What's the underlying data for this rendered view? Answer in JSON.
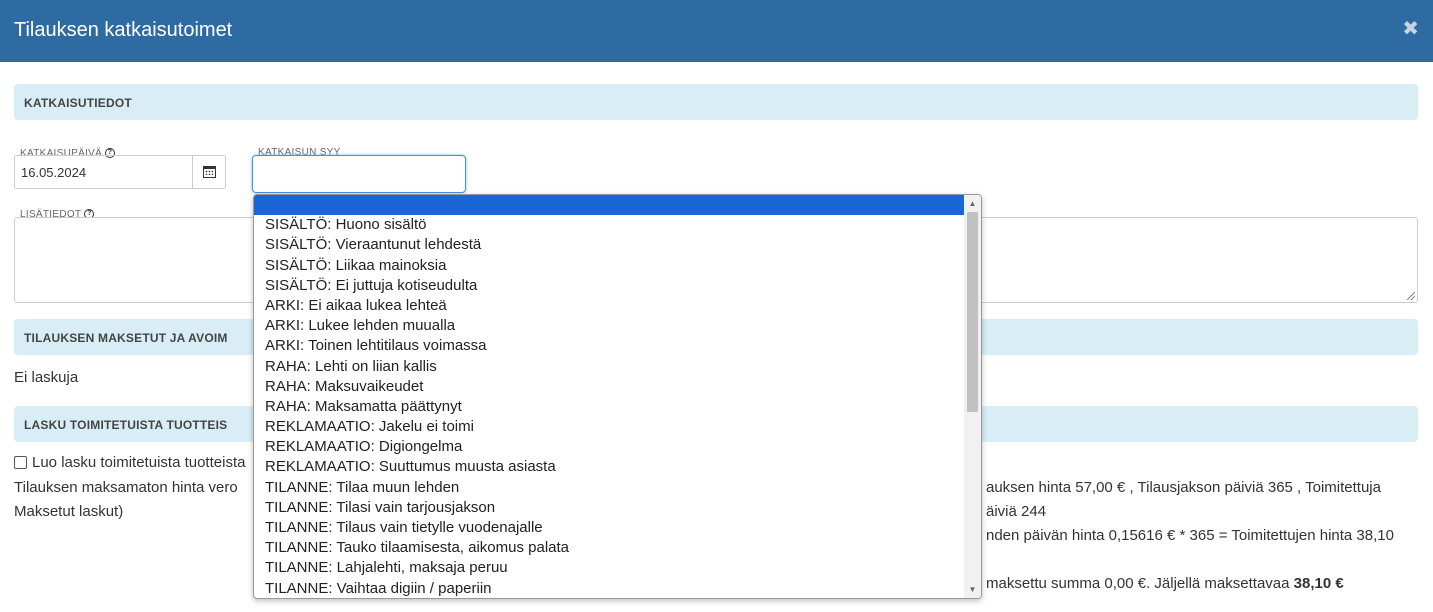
{
  "dialog": {
    "title": "Tilauksen katkaisutoimet",
    "close_glyph": "✖"
  },
  "sections": {
    "details": "KATKAISUTIEDOT",
    "payments": "TILAUKSEN MAKSETUT JA AVOIM",
    "invoice": "LASKU TOIMITETUISTA TUOTTEIS"
  },
  "fields": {
    "date_label": "KATKAISUPÄIVÄ",
    "date_value": "16.05.2024",
    "reason_label": "KATKAISUN SYY",
    "extra_label": "LISÄTIEDOT",
    "help_glyph": "?"
  },
  "payments": {
    "no_invoices": "Ei laskuja"
  },
  "invoice": {
    "checkbox_label": "Luo lasku toimitetuista tuotteista",
    "line1_left": "Tilauksen maksamaton hinta vero",
    "line2_left": "Maksetut laskut)",
    "line1_right": "auksen hinta 57,00 € , Tilausjakson päiviä 365 , Toimitettuja",
    "line2_right": "äiviä 244",
    "line3_right": "nden päivän hinta 0,15616 € * 365 = Toimitettujen hinta 38,10",
    "line4_right_prefix": "maksettu summa 0,00 €. Jäljellä maksettavaa",
    "line4_right_amount": "38,10 €"
  },
  "dropdown": {
    "options": [
      "",
      "SISÄLTÖ: Huono sisältö",
      "SISÄLTÖ: Vieraantunut lehdestä",
      "SISÄLTÖ: Liikaa mainoksia",
      "SISÄLTÖ: Ei juttuja kotiseudulta",
      "ARKI: Ei aikaa lukea lehteä",
      "ARKI: Lukee lehden muualla",
      "ARKI: Toinen lehtitilaus voimassa",
      "RAHA: Lehti on liian kallis",
      "RAHA: Maksuvaikeudet",
      "RAHA: Maksamatta päättynyt",
      "REKLAMAATIO: Jakelu ei toimi",
      "REKLAMAATIO: Digiongelma",
      "REKLAMAATIO: Suuttumus muusta asiasta",
      "TILANNE: Tilaa muun lehden",
      "TILANNE: Tilasi vain tarjousjakson",
      "TILANNE: Tilaus vain tietylle vuodenajalle",
      "TILANNE: Tauko tilaamisesta, aikomus palata",
      "TILANNE: Lahjalehti, maksaja peruu",
      "TILANNE: Vaihtaa digiin / paperiin"
    ],
    "selected_index": 0,
    "scroll_up_glyph": "▲",
    "scroll_down_glyph": "▼",
    "selected_color": "#1a66d4"
  },
  "colors": {
    "header": "#2f6ba3",
    "section": "#d9edf7",
    "focus": "#4a90d9"
  }
}
